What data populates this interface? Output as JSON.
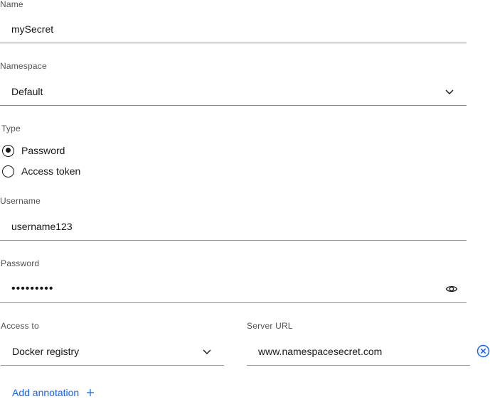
{
  "form": {
    "name": {
      "label": "Name",
      "value": "mySecret"
    },
    "namespace": {
      "label": "Namespace",
      "value": "Default"
    },
    "type": {
      "label": "Type",
      "options": [
        {
          "label": "Password",
          "checked": true
        },
        {
          "label": "Access token",
          "checked": false
        }
      ]
    },
    "username": {
      "label": "Username",
      "value": "username123"
    },
    "password": {
      "label": "Password",
      "value": "•••••••••"
    },
    "access_to": {
      "label": "Access to",
      "value": "Docker registry"
    },
    "server_url": {
      "label": "Server URL",
      "value": "www.namespacesecret.com"
    },
    "add_annotation": {
      "label": "Add annotation"
    }
  },
  "icons": {
    "namespace_dropdown": "chevron-down-icon",
    "password_visibility": "eye-icon",
    "access_to_dropdown": "chevron-down-icon",
    "remove_server_url": "close-circle-icon",
    "add_annotation": "plus-icon"
  },
  "colors": {
    "text": "#161616",
    "label": "#525252",
    "border": "#8d8d8d",
    "link": "#0f62fe"
  }
}
